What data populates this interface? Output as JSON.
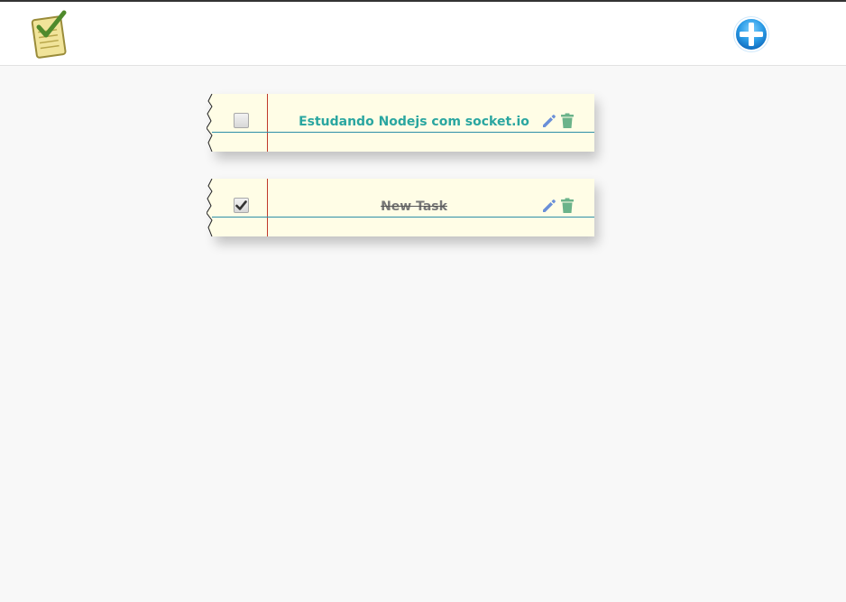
{
  "header": {
    "logo_icon": "checklist-notepad-icon",
    "add_icon": "add-circle-icon"
  },
  "tasks": [
    {
      "label": "Estudando Nodejs com socket.io",
      "completed": false,
      "edit_icon": "pencil-icon",
      "delete_icon": "trash-icon"
    },
    {
      "label": "New Task",
      "completed": true,
      "edit_icon": "pencil-icon",
      "delete_icon": "trash-icon"
    }
  ],
  "colors": {
    "active_text": "#2aa6a0",
    "done_text": "#777777",
    "card_bg": "#fffde6",
    "margin_line": "#c0392b",
    "rule_line": "#2f8fa8",
    "edit_icon": "#6a8fd8",
    "trash_icon": "#6bb38a",
    "page_bg": "#f8f8f8"
  }
}
